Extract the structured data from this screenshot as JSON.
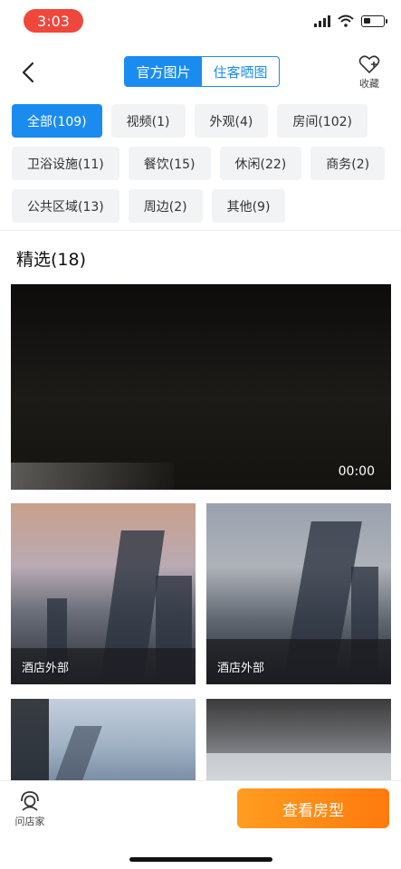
{
  "status_bar": {
    "time": "3:03"
  },
  "nav": {
    "tabs": [
      {
        "label": "官方图片",
        "active": true
      },
      {
        "label": "住客晒图",
        "active": false
      }
    ],
    "favorite_label": "收藏",
    "accent_color": "#1a8cf0"
  },
  "filters": [
    [
      {
        "label": "全部(109)",
        "active": true
      },
      {
        "label": "视频(1)"
      },
      {
        "label": "外观(4)"
      },
      {
        "label": "房间(102)"
      }
    ],
    [
      {
        "label": "卫浴设施(11)"
      },
      {
        "label": "餐饮(15)"
      },
      {
        "label": "休闲(22)"
      },
      {
        "label": "商务(2)"
      }
    ],
    [
      {
        "label": "公共区域(13)"
      },
      {
        "label": "周边(2)"
      },
      {
        "label": "其他(9)"
      }
    ]
  ],
  "section": {
    "title": "精选(18)"
  },
  "video": {
    "duration": "00:00"
  },
  "photos": [
    {
      "caption": "酒店外部"
    },
    {
      "caption": "酒店外部"
    },
    {
      "caption": ""
    },
    {
      "caption": ""
    }
  ],
  "bottom": {
    "ask_label": "问店家",
    "cta_label": "查看房型",
    "cta_color": "#ff8a12"
  }
}
